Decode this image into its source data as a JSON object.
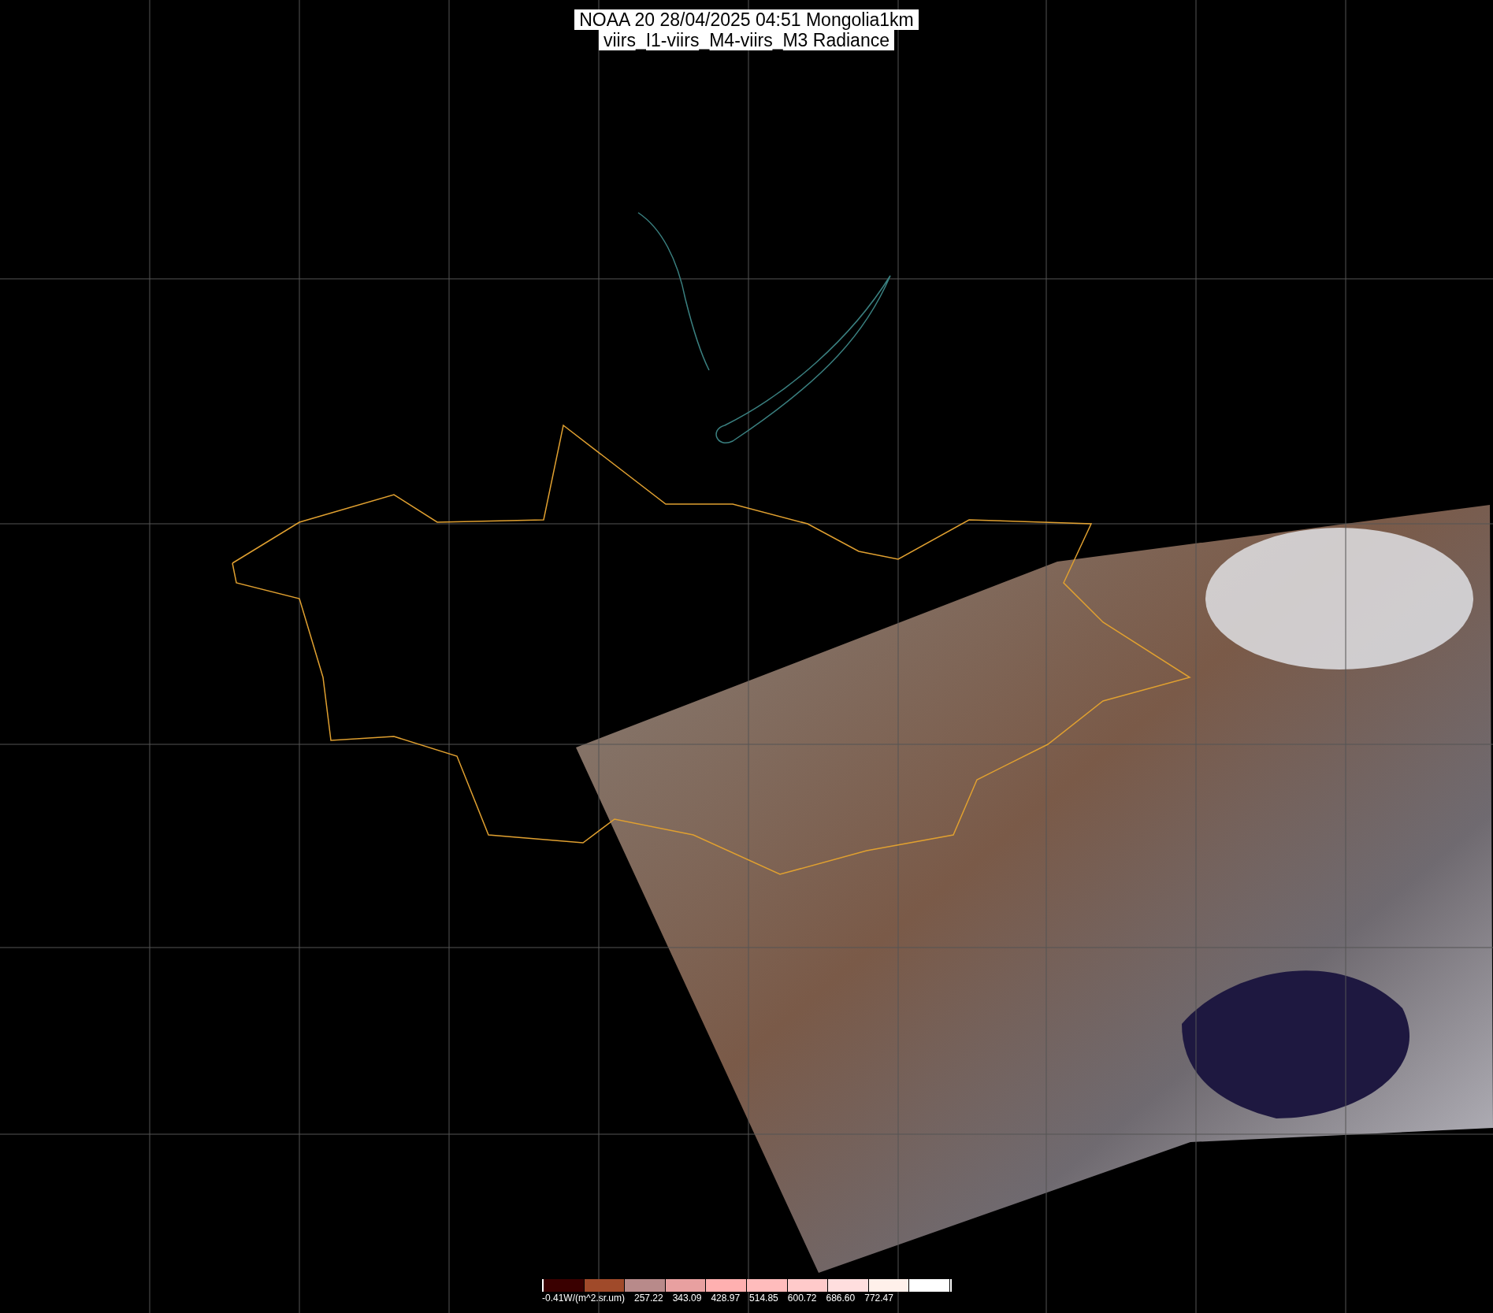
{
  "title_lines": [
    "NOAA 20 28/04/2025 04:51 Mongolia1km",
    "viirs_I1-viirs_M4-viirs_M3 Radiance"
  ],
  "color_scale": {
    "labels": [
      "-0.41W/(m^2.sr.um)",
      "257.22",
      "343.09",
      "428.97",
      "514.85",
      "600.72",
      "686.60",
      "772.47"
    ]
  }
}
